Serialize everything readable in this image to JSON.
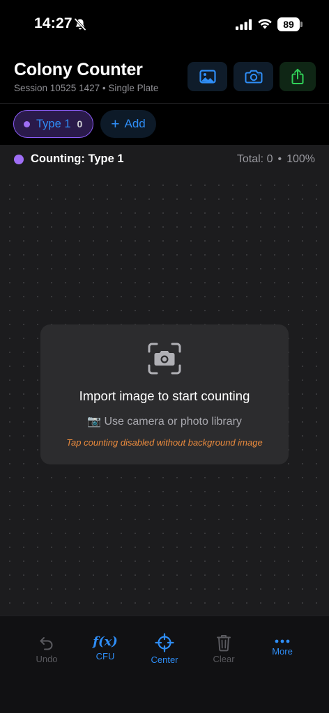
{
  "status_bar": {
    "time": "14:27",
    "battery": "89"
  },
  "header": {
    "title": "Colony Counter",
    "session": "Session 10525 1427 • Single Plate",
    "buttons": {
      "photo": "photo-icon",
      "camera": "camera-icon",
      "share": "share-icon"
    }
  },
  "types": {
    "active": {
      "label": "Type 1",
      "count": "0",
      "color": "#9f6ef5"
    },
    "add_label": "Add"
  },
  "counting_bar": {
    "title": "Counting: Type 1",
    "total": "Total: 0",
    "separator": "•",
    "zoom": "100%"
  },
  "empty_state": {
    "title": "Import image to start counting",
    "subtitle": "📷 Use camera or photo library",
    "warning": "Tap counting disabled without background image"
  },
  "tab_bar": {
    "undo": "Undo",
    "cfu": "CFU",
    "cfu_icon_text": "f(x)",
    "center": "Center",
    "clear": "Clear",
    "more": "More"
  },
  "colors": {
    "accent": "#2f8ef7",
    "type_purple": "#9f6ef5",
    "share_green": "#30d158",
    "warning_orange": "#e98a3d"
  }
}
